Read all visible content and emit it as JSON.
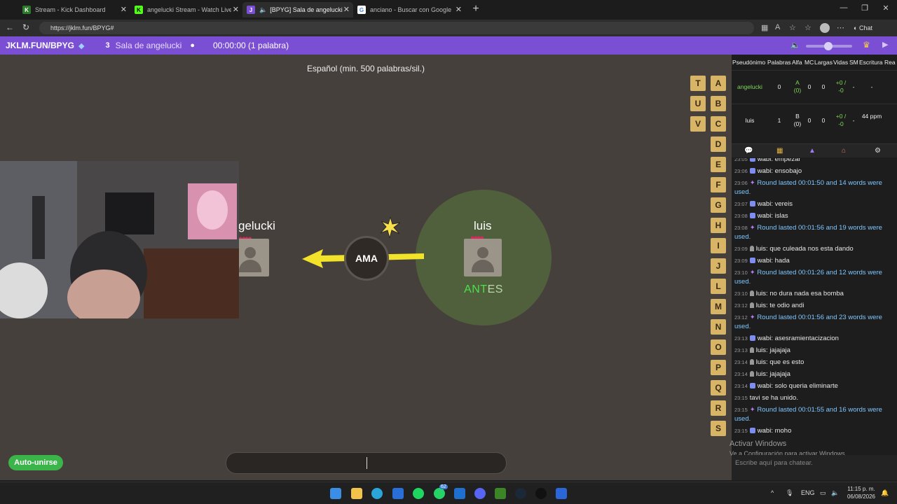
{
  "browser": {
    "tabs": [
      {
        "label": "Stream - Kick Dashboard"
      },
      {
        "label": "angelucki Stream - Watch Live on"
      },
      {
        "label": "[BPYG] Sala de angelucki"
      },
      {
        "label": "anciano - Buscar con Google"
      }
    ],
    "url": "https://jklm.fun/BPYG#",
    "chat_button": "Chat"
  },
  "game_header": {
    "site": "JKLM.FUN/BPYG",
    "room_count": "3",
    "room_name": "Sala de angelucki",
    "timer": "00:00:00 (1 palabra)"
  },
  "stage": {
    "language": "Español (min. 500 palabras/sil.)",
    "letters_col1": [
      "T",
      "U",
      "V"
    ],
    "letters_col2": [
      "A",
      "B",
      "C",
      "D",
      "E",
      "F",
      "G",
      "H",
      "I",
      "J",
      "L",
      "M",
      "N",
      "O",
      "P",
      "Q",
      "R",
      "S"
    ],
    "player_left": "gelucki",
    "player_right": "luis",
    "syllable": "AMA",
    "word_typed_highlight": "ANT",
    "word_typed_rest": "ES",
    "autojoin": "Auto-unirse"
  },
  "players_table": {
    "headers": [
      "Pseudónimo",
      "Palabras",
      "Alfa",
      "MC",
      "Largas",
      "Vidas",
      "SM",
      "Escritura",
      "Rea"
    ],
    "rows": [
      {
        "name": "angelucki",
        "palabras": "0",
        "alfa": "A (0)",
        "mc": "0",
        "largas": "0",
        "vidas": "+0 / -0",
        "sm": "-",
        "escritura": "-"
      },
      {
        "name": "luis",
        "palabras": "1",
        "alfa": "B (0)",
        "mc": "0",
        "largas": "0",
        "vidas": "+0 / -0",
        "sm": "-",
        "escritura": "44 ppm"
      }
    ]
  },
  "chat": {
    "messages": [
      {
        "time": "23:05",
        "user": "wabi",
        "text": "empezar",
        "type": "user"
      },
      {
        "time": "23:06",
        "user": "wabi",
        "text": "ensobajo",
        "type": "user"
      },
      {
        "time": "23:06",
        "user": "",
        "text": "Round lasted 00:01:50 and 14 words were used.",
        "type": "sys"
      },
      {
        "time": "23:07",
        "user": "wabi",
        "text": "vereis",
        "type": "user"
      },
      {
        "time": "23:08",
        "user": "wabi",
        "text": "islas",
        "type": "user"
      },
      {
        "time": "23:08",
        "user": "",
        "text": "Round lasted 00:01:56 and 19 words were used.",
        "type": "sys"
      },
      {
        "time": "23:09",
        "user": "luis",
        "text": "que culeada nos esta dando",
        "type": "user2"
      },
      {
        "time": "23:09",
        "user": "wabi",
        "text": "hada",
        "type": "user"
      },
      {
        "time": "23:10",
        "user": "",
        "text": "Round lasted 00:01:26 and 12 words were used.",
        "type": "sys"
      },
      {
        "time": "23:10",
        "user": "luis",
        "text": "no dura nada esa bomba",
        "type": "user2"
      },
      {
        "time": "23:12",
        "user": "luis",
        "text": "te odio andi",
        "type": "user2"
      },
      {
        "time": "23:12",
        "user": "",
        "text": "Round lasted 00:01:56 and 23 words were used.",
        "type": "sys"
      },
      {
        "time": "23:13",
        "user": "wabi",
        "text": "asesramientacizacion",
        "type": "user"
      },
      {
        "time": "23:13",
        "user": "luis",
        "text": "jajajaja",
        "type": "user2"
      },
      {
        "time": "23:14",
        "user": "luis",
        "text": "que es esto",
        "type": "user2"
      },
      {
        "time": "23:14",
        "user": "luis",
        "text": "jajajaja",
        "type": "user2"
      },
      {
        "time": "23:14",
        "user": "wabi",
        "text": "solo queria eliminarte",
        "type": "user"
      },
      {
        "time": "23:15",
        "user": "",
        "text": "tavi se ha unido.",
        "type": "join"
      },
      {
        "time": "23:15",
        "user": "",
        "text": "Round lasted 00:01:55 and 16 words were used.",
        "type": "sys"
      },
      {
        "time": "23:15",
        "user": "wabi",
        "text": "moho",
        "type": "user"
      }
    ],
    "watermark_title": "Activar Windows",
    "watermark_sub": "Ve a Configuración para activar Windows.",
    "placeholder": "Escribe aquí para chatear."
  },
  "taskbar": {
    "lang": "ENG",
    "time": "11:15 p. m.",
    "date": "06/08/2026",
    "badge_whatsapp": "62"
  },
  "colors": {
    "accent": "#7b4fd4",
    "stage": "#46403c",
    "letter_tile": "#d7b466",
    "autojoin": "#3bb54a",
    "correct": "#4ce04c"
  }
}
